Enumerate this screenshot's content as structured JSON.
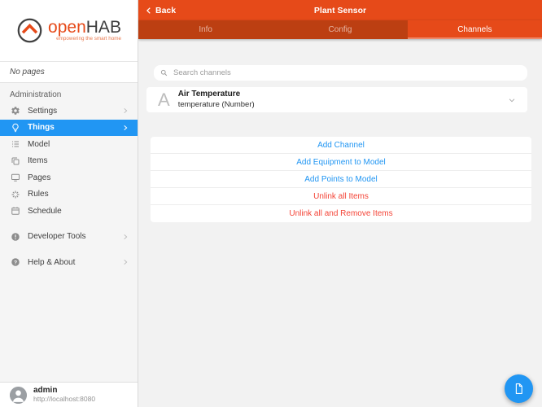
{
  "colors": {
    "accent_orange": "#e64a19",
    "tabbar_dark_orange": "#bc3f12",
    "selection_blue": "#2196f3",
    "link_blue": "#2196f3",
    "danger_red": "#f44336"
  },
  "navbar": {
    "back_label": "Back",
    "title": "Plant Sensor"
  },
  "tabs": {
    "info": "Info",
    "config": "Config",
    "channels": "Channels",
    "active_tab": "Channels"
  },
  "sidebar": {
    "brand": {
      "word_open": "open",
      "word_hab": "HAB",
      "tagline": "empowering the smart home"
    },
    "no_pages_label": "No pages",
    "section_label": "Administration",
    "items": [
      {
        "label": "Settings",
        "icon": "gear-icon"
      },
      {
        "label": "Things",
        "icon": "lightbulb-icon",
        "active": true
      },
      {
        "label": "Model",
        "icon": "model-list-icon"
      },
      {
        "label": "Items",
        "icon": "copy-icon"
      },
      {
        "label": "Pages",
        "icon": "monitor-icon"
      },
      {
        "label": "Rules",
        "icon": "sparkle-icon"
      },
      {
        "label": "Schedule",
        "icon": "calendar-icon"
      }
    ],
    "footer_items": [
      {
        "label": "Developer Tools",
        "icon": "exclamation-circle-icon"
      },
      {
        "label": "Help & About",
        "icon": "question-circle-icon"
      }
    ],
    "user": {
      "name": "admin",
      "server_url": "http://localhost:8080"
    }
  },
  "main": {
    "search_placeholder": "Search channels",
    "channel": {
      "badge_letter": "A",
      "title": "Air Temperature",
      "subtitle": "temperature (Number)"
    },
    "actions": [
      {
        "label": "Add Channel",
        "style": "blue"
      },
      {
        "label": "Add Equipment to Model",
        "style": "blue"
      },
      {
        "label": "Add Points to Model",
        "style": "blue"
      },
      {
        "label": "Unlink all Items",
        "style": "red"
      },
      {
        "label": "Unlink all and Remove Items",
        "style": "red"
      }
    ]
  }
}
